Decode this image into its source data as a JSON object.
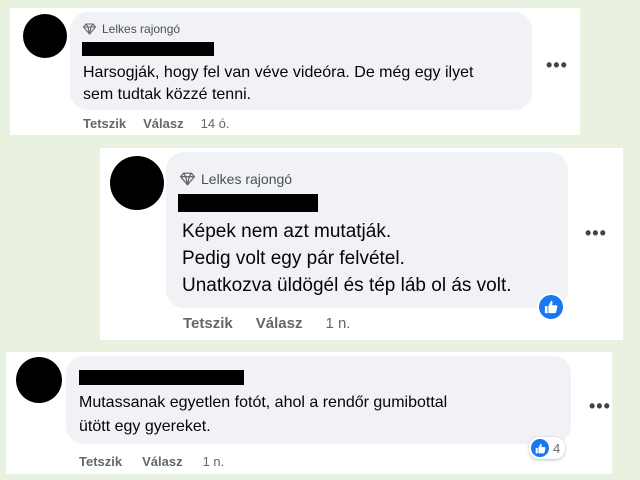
{
  "comments": [
    {
      "badge": "Lelkes rajongó",
      "text_lines": [
        "Harsogják, hogy fel van véve videóra. De még egy ilyet",
        "sem tudtak közzé tenni."
      ],
      "more": "•••",
      "like": "Tetszik",
      "reply": "Válasz",
      "time": "14 ó."
    },
    {
      "badge": "Lelkes rajongó",
      "text_lines": [
        "Képek nem azt mutatják.",
        "Pedig volt egy pár felvétel.",
        "Unatkozva üldögél és tép láb ol ás volt."
      ],
      "more": "•••",
      "like": "Tetszik",
      "reply": "Válasz",
      "time": "1 n."
    },
    {
      "text_lines": [
        "Mutassanak egyetlen fotót, ahol a rendőr gumibottal",
        "ütött egy gyereket."
      ],
      "more": "•••",
      "like": "Tetszik",
      "reply": "Válasz",
      "time": "1 n.",
      "reaction_count": "4"
    }
  ],
  "icons": {
    "badge": "diamond-icon",
    "reaction": "thumbs-up-icon",
    "more": "more-options-icon"
  },
  "colors": {
    "background": "#e9f1e0",
    "bubble": "#f0f2f5",
    "like_blue": "#1877f2",
    "meta_gray": "#65676b"
  }
}
